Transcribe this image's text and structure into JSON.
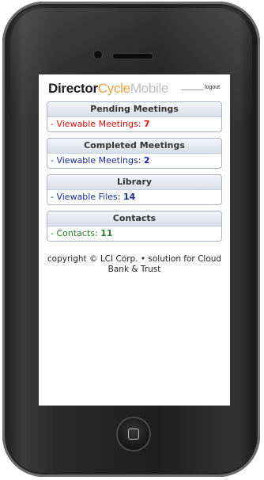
{
  "app": {
    "brand_part1": "Director",
    "brand_part2": "Cycle",
    "brand_part3": "Mobile",
    "logout_label": "logout"
  },
  "panels": [
    {
      "title": "Pending Meetings",
      "row_label": "- Viewable Meetings: ",
      "count": "7",
      "color": "#e01010"
    },
    {
      "title": "Completed Meetings",
      "row_label": "- Viewable Meetings: ",
      "count": "2",
      "color": "#1a2a9a"
    },
    {
      "title": "Library",
      "row_label": "- Viewable Files: ",
      "count": "14",
      "color": "#1a2a9a"
    },
    {
      "title": "Contacts",
      "row_label": "- Contacts: ",
      "count": "11",
      "color": "#2b7d2b"
    }
  ],
  "footer": {
    "text": "copyright © LCI Corp. • solution for Cloud Bank & Trust"
  },
  "icons": {
    "home_button": "home-button-icon"
  }
}
